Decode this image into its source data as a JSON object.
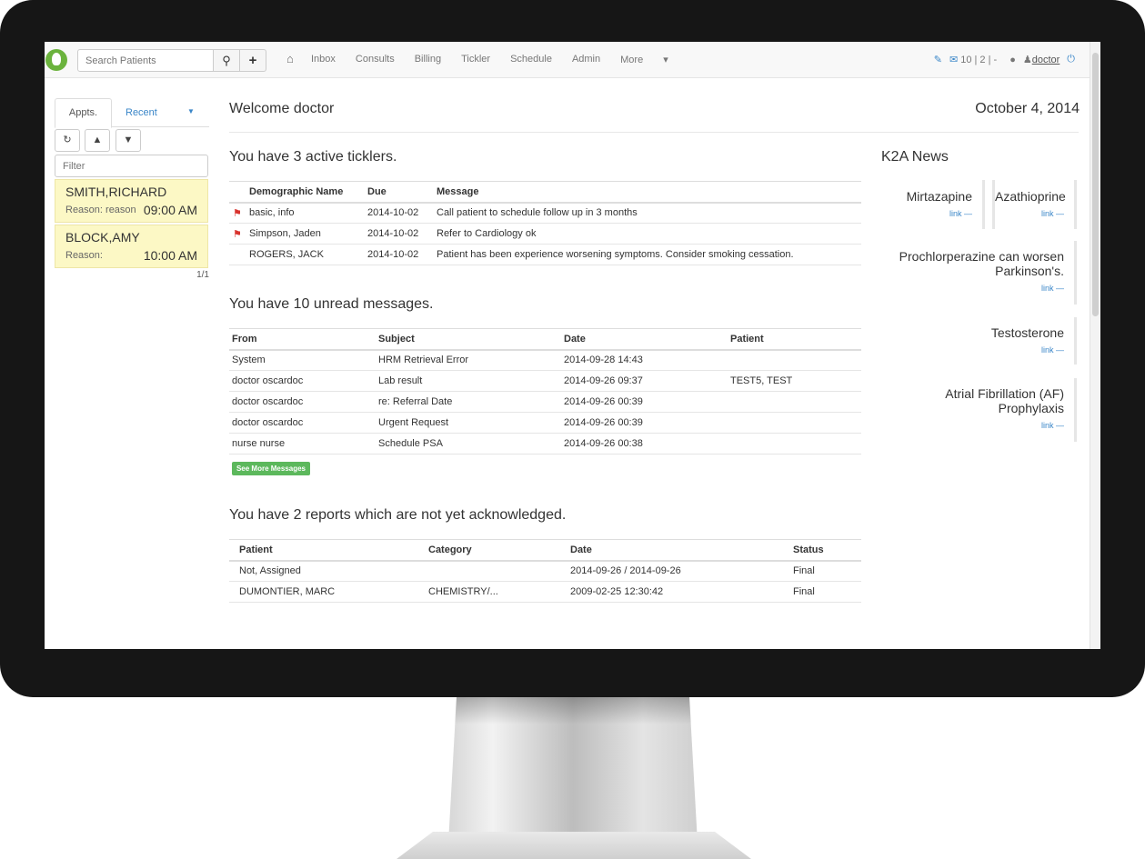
{
  "navbar": {
    "search_placeholder": "Search Patients",
    "search_icon": "search-icon",
    "add_icon": "plus-icon",
    "home_icon": "home-icon",
    "links": [
      "Inbox",
      "Consults",
      "Billing",
      "Tickler",
      "Schedule",
      "Admin",
      "More"
    ],
    "more_caret": "▾",
    "message_counts": "10 | 2 | -",
    "user": "doctor"
  },
  "left": {
    "tab_appts": "Appts.",
    "tab_recent": "Recent",
    "filter_placeholder": "Filter",
    "appointments": [
      {
        "name": "SMITH,RICHARD",
        "reason": "Reason: reason",
        "time": "09:00 AM"
      },
      {
        "name": "BLOCK,AMY",
        "reason": "Reason:",
        "time": "10:00 AM"
      }
    ],
    "pager": "1/1"
  },
  "main": {
    "welcome": "Welcome doctor",
    "date": "October 4, 2014",
    "ticklers_title": "You have 3 active ticklers.",
    "ticklers_headers": [
      "Demographic Name",
      "Due",
      "Message"
    ],
    "ticklers": [
      {
        "flag": true,
        "name": "basic, info",
        "due": "2014-10-02",
        "message": "Call patient to schedule follow up in 3 months"
      },
      {
        "flag": true,
        "name": "Simpson, Jaden",
        "due": "2014-10-02",
        "message": "Refer to Cardiology ok"
      },
      {
        "flag": false,
        "name": "ROGERS, JACK",
        "due": "2014-10-02",
        "message": "Patient has been experience worsening symptoms. Consider smoking cessation."
      }
    ],
    "messages_title": "You have 10 unread messages.",
    "messages_headers": [
      "From",
      "Subject",
      "Date",
      "Patient"
    ],
    "messages": [
      {
        "from": "System",
        "subject": "HRM Retrieval Error",
        "date": "2014-09-28 14:43",
        "patient": ""
      },
      {
        "from": "doctor oscardoc",
        "subject": "Lab result",
        "date": "2014-09-26 09:37",
        "patient": "TEST5, TEST"
      },
      {
        "from": "doctor oscardoc",
        "subject": "re: Referral Date",
        "date": "2014-09-26 00:39",
        "patient": ""
      },
      {
        "from": "doctor oscardoc",
        "subject": "Urgent Request",
        "date": "2014-09-26 00:39",
        "patient": ""
      },
      {
        "from": "nurse nurse",
        "subject": "Schedule PSA",
        "date": "2014-09-26 00:38",
        "patient": ""
      }
    ],
    "see_more": "See More Messages",
    "reports_title": "You have 2 reports which are not yet acknowledged.",
    "reports_headers": [
      "Patient",
      "Category",
      "Date",
      "Status"
    ],
    "reports": [
      {
        "patient": "Not, Assigned",
        "category": "",
        "date": "2014-09-26 / 2014-09-26",
        "status": "Final"
      },
      {
        "patient": "DUMONTIER, MARC",
        "category": "CHEMISTRY/...",
        "date": "2009-02-25 12:30:42",
        "status": "Final"
      }
    ]
  },
  "news": {
    "title": "K2A News",
    "items": [
      {
        "title": "Mirtazapine",
        "link": "link —"
      },
      {
        "title": "Azathioprine",
        "link": "link —"
      },
      {
        "title": "Prochlorperazine can worsen Parkinson's.",
        "link": "link —"
      },
      {
        "title": "Testosterone",
        "link": "link —"
      },
      {
        "title": "Atrial Fibrillation (AF) Prophylaxis",
        "link": "link —"
      }
    ]
  }
}
